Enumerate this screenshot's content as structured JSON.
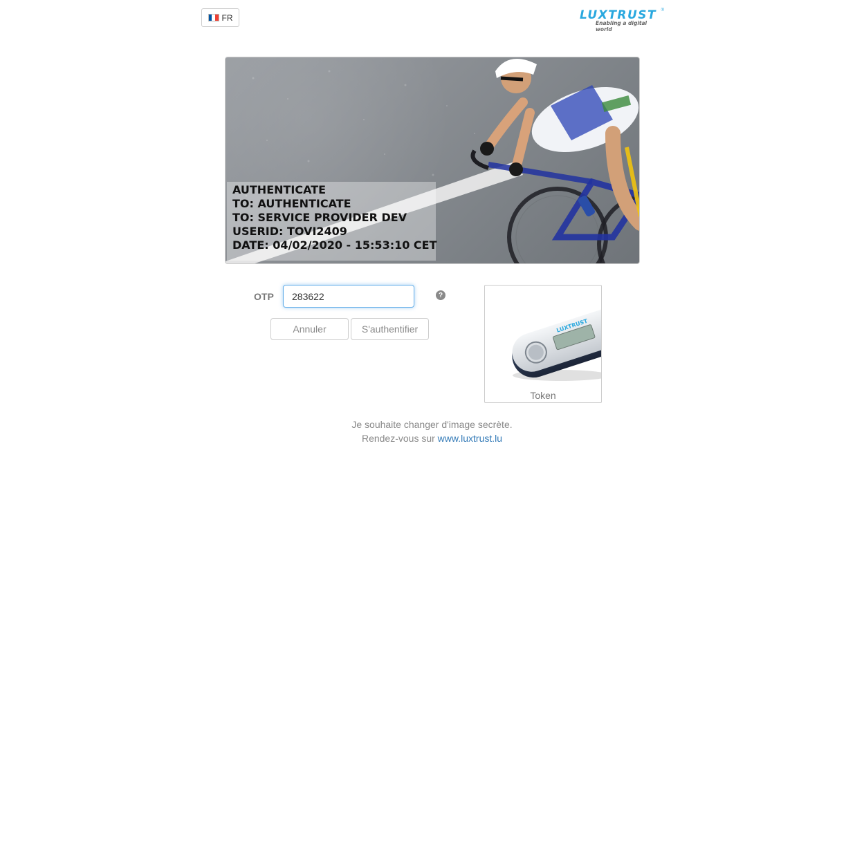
{
  "header": {
    "language_button_label": "FR",
    "flag_colors": [
      "#0055a4",
      "#ffffff",
      "#ef4135"
    ],
    "logo_text": "LUXTRUST",
    "logo_registered": "®",
    "logo_tagline": "Enabling a digital world",
    "brand_color": "#29a8df"
  },
  "secret_image": {
    "lines": [
      "AUTHENTICATE",
      "TO: AUTHENTICATE",
      "TO: SERVICE PROVIDER DEV",
      "USERID: TOVI2409",
      "DATE: 04/02/2020 - 15:53:10 CET"
    ]
  },
  "form": {
    "otp_label": "OTP",
    "otp_value": "283622",
    "help_icon": "question-circle-icon",
    "cancel_label": "Annuler",
    "authenticate_label": "S'authentifier"
  },
  "token_card": {
    "label": "Token",
    "device_brand": "LUXTRUST"
  },
  "footer": {
    "line1": "Je souhaite changer d'image secrète.",
    "line2_prefix": "Rendez-vous sur",
    "link_text": "www.luxtrust.lu",
    "link_color": "#337ab7"
  }
}
